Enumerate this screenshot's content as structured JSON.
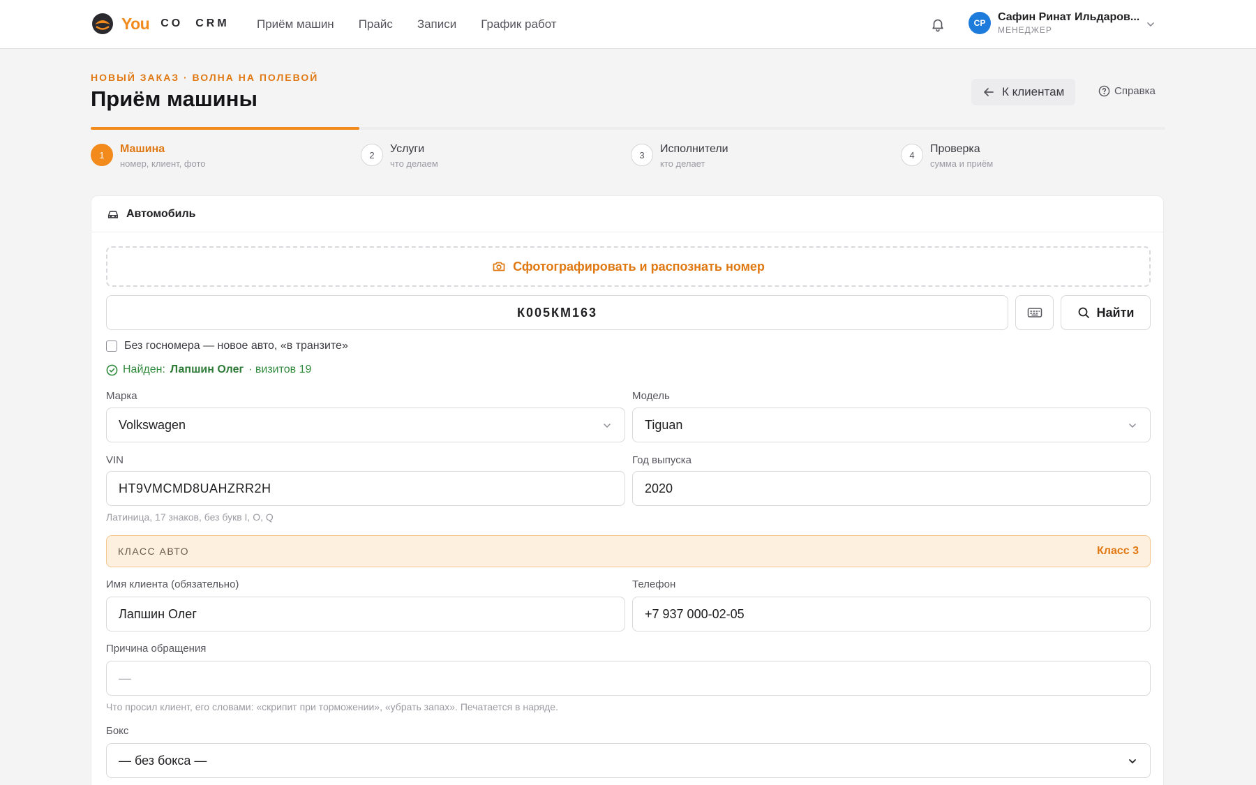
{
  "brand": {
    "you": "You",
    "co": "CO",
    "crm": "CRM"
  },
  "nav": [
    "Приём машин",
    "Прайс",
    "Записи",
    "График работ"
  ],
  "user": {
    "initials": "СР",
    "name": "Сафин Ринат Ильдаров...",
    "role": "МЕНЕДЖЕР"
  },
  "header": {
    "eyebrow": "НОВЫЙ ЗАКАЗ · ВОЛНА НА ПОЛЕВОЙ",
    "title": "Приём машины",
    "back_label": "К клиентам",
    "help_label": "Справка"
  },
  "progress": {
    "current_step": 1,
    "total_steps": 4
  },
  "steps": [
    {
      "num": "1",
      "title": "Машина",
      "sub": "номер, клиент, фото"
    },
    {
      "num": "2",
      "title": "Услуги",
      "sub": "что делаем"
    },
    {
      "num": "3",
      "title": "Исполнители",
      "sub": "кто делает"
    },
    {
      "num": "4",
      "title": "Проверка",
      "sub": "сумма и приём"
    }
  ],
  "card": {
    "title": "Автомобиль",
    "photo_label": "Сфотографировать и распознать номер",
    "plate_value": "К005КМ163",
    "find_label": "Найти",
    "no_plate_label": "Без госномера — новое авто, «в транзите»",
    "found": {
      "prefix": "Найден:",
      "name": "Лапшин Олег",
      "visits": "· визитов 19"
    },
    "brand": {
      "label": "Марка",
      "value": "Volkswagen"
    },
    "model": {
      "label": "Модель",
      "value": "Tiguan"
    },
    "vin": {
      "label": "VIN",
      "value": "HT9VMCMD8UAHZRR2H",
      "hint": "Латиница, 17 знаков, без букв I, O, Q"
    },
    "year": {
      "label": "Год выпуска",
      "value": "2020"
    },
    "car_class": {
      "label": "КЛАСС АВТО",
      "value": "Класс 3"
    },
    "client_name": {
      "label": "Имя клиента (обязательно)",
      "value": "Лапшин Олег"
    },
    "phone": {
      "label": "Телефон",
      "value": "+7 937 000-02-05"
    },
    "reason": {
      "label": "Причина обращения",
      "placeholder": "—",
      "hint": "Что просил клиент, его словами: «скрипит при торможении», «убрать запах». Печатается в наряде."
    },
    "box": {
      "label": "Бокс",
      "value": "— без бокса —"
    }
  },
  "colors": {
    "accent": "#f28a1c",
    "success": "#2f8a3c",
    "avatar": "#1d7bdb"
  }
}
